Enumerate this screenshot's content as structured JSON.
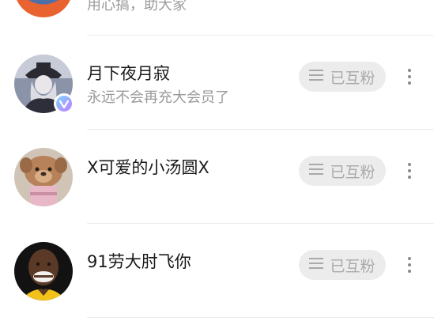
{
  "partial_row": {
    "subtitle": "用心搞，助大家"
  },
  "rows": [
    {
      "name": "月下夜月寂",
      "subtitle": "永远不会再充大会员了",
      "follow_label": "已互粉",
      "has_badge": true
    },
    {
      "name": "X可爱的小汤圆X",
      "subtitle": "",
      "follow_label": "已互粉",
      "has_badge": false
    },
    {
      "name": "91劳大肘飞你",
      "subtitle": "",
      "follow_label": "已互粉",
      "has_badge": false
    }
  ],
  "colors": {
    "button_bg": "#ececec",
    "button_text": "#a9a9a9",
    "name_text": "#1a1a1a",
    "subtitle_text": "#9a9a9a",
    "badge_accent": "#b36bff"
  },
  "icons": {
    "follow_button": "list-icon",
    "more": "more-vertical-icon",
    "badge": "vip-heart-icon"
  }
}
